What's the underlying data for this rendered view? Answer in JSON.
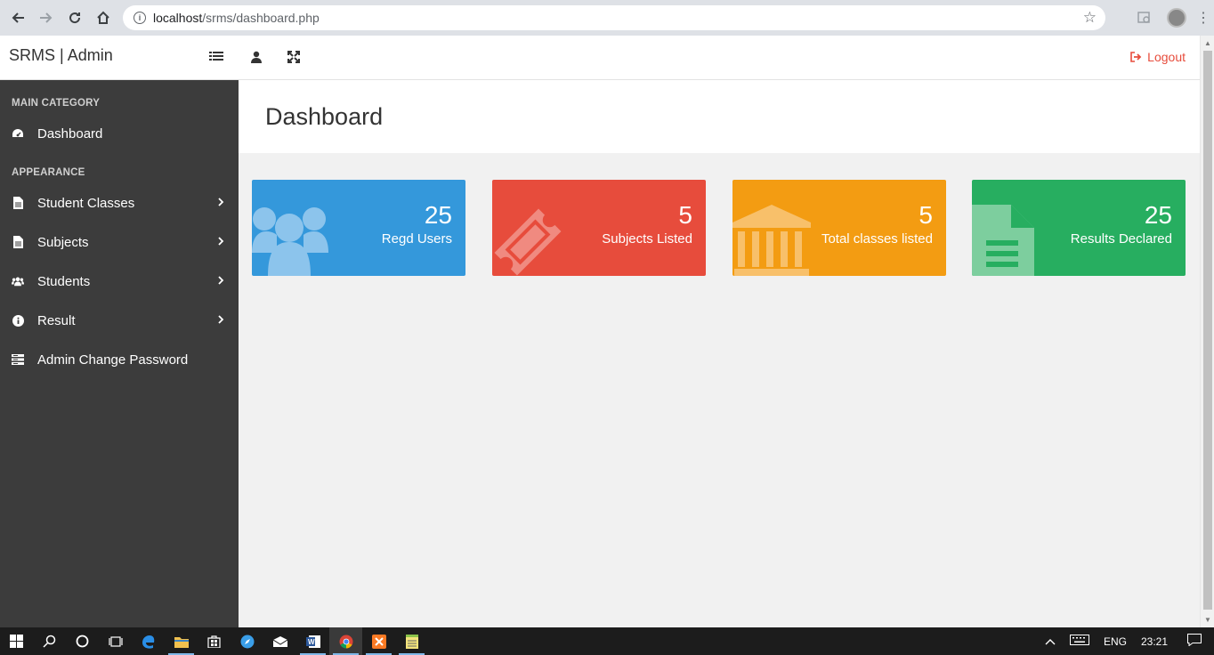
{
  "browser": {
    "url_host": "localhost",
    "url_path": "/srms/dashboard.php"
  },
  "header": {
    "brand": "SRMS | Admin",
    "logout_label": "Logout"
  },
  "sidebar": {
    "sections": [
      {
        "title": "MAIN CATEGORY"
      },
      {
        "title": "APPEARANCE"
      }
    ],
    "items": [
      {
        "label": "Dashboard",
        "icon": "dashboard-icon"
      },
      {
        "label": "Student Classes",
        "icon": "file-icon"
      },
      {
        "label": "Subjects",
        "icon": "file-icon"
      },
      {
        "label": "Students",
        "icon": "users-icon"
      },
      {
        "label": "Result",
        "icon": "info-icon"
      },
      {
        "label": "Admin Change Password",
        "icon": "server-icon"
      }
    ]
  },
  "page": {
    "title": "Dashboard"
  },
  "cards": [
    {
      "count": "25",
      "label": "Regd Users",
      "color": "#3498db",
      "icon": "users-icon"
    },
    {
      "count": "5",
      "label": "Subjects Listed",
      "color": "#e74c3c",
      "icon": "ticket-icon"
    },
    {
      "count": "5",
      "label": "Total classes listed",
      "color": "#f39c12",
      "icon": "bank-icon"
    },
    {
      "count": "25",
      "label": "Results Declared",
      "color": "#27ae60",
      "icon": "file-text-icon"
    }
  ],
  "taskbar": {
    "language": "ENG",
    "time": "23:21"
  }
}
